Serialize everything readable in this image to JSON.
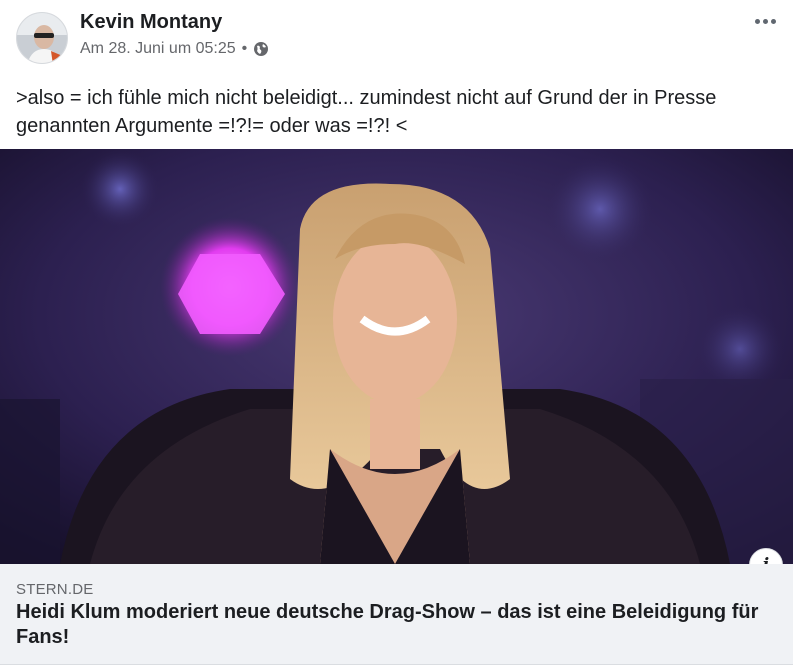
{
  "post": {
    "author": "Kevin Montany",
    "timestamp": "Am 28. Juni um 05:25",
    "separator": "•",
    "audience_icon": "globe-icon",
    "menu_icon": "more-options-icon",
    "text": ">also = ich fühle mich nicht beleidigt... zumindest nicht auf Grund der in Presse genannten Argumente =!?!= oder was =!?! <"
  },
  "link": {
    "image_description_icon": "info-icon",
    "domain": "STERN.DE",
    "title": "Heidi Klum moderiert neue deutsche Drag-Show – das ist eine Beleidigung für Fans!",
    "info_label": "i"
  },
  "colors": {
    "text_primary": "#1c1e21",
    "text_secondary": "#65676b",
    "preview_bg": "#f0f2f5",
    "stage_purple": "#3b2a5a",
    "stage_light": "#e23cf0"
  }
}
